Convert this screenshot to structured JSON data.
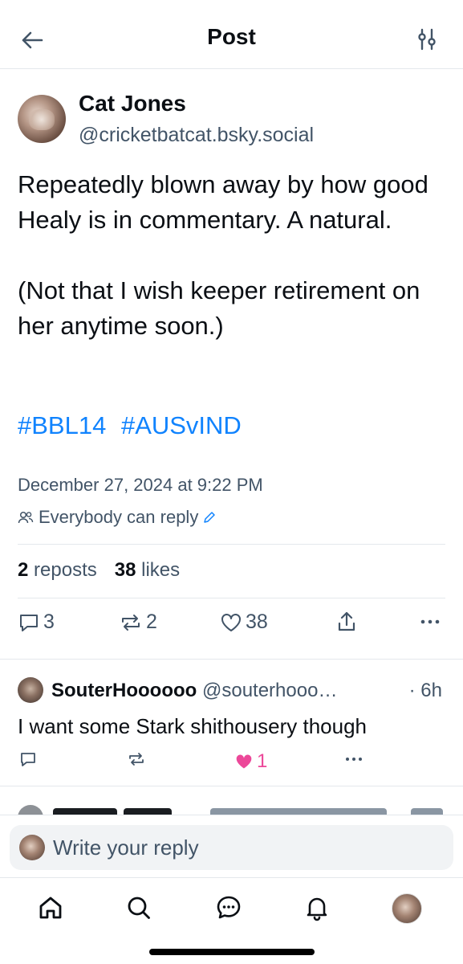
{
  "header": {
    "title": "Post"
  },
  "post": {
    "author_name": "Cat Jones",
    "author_handle": "@cricketbatcat.bsky.social",
    "text": "Repeatedly blown away by how good Healy is in commentary. A natural.\n\n(Not that I wish keeper retirement on her anytime soon.)",
    "hashtags": [
      "#BBL14",
      "#AUSvIND"
    ],
    "timestamp": "December 27, 2024 at 9:22 PM",
    "reply_setting": "Everybody can reply",
    "reposts_count": "2",
    "reposts_label": "reposts",
    "likes_count": "38",
    "likes_label": "likes",
    "actions": {
      "replies": "3",
      "reposts": "2",
      "likes": "38"
    }
  },
  "reply": {
    "name": "SouterHoooooo",
    "handle": "@souterhooo…",
    "time": "· 6h",
    "text": "I want some Stark shithousery though",
    "likes": "1",
    "accent_color": "#ec4899"
  },
  "composer": {
    "placeholder": "Write your reply"
  },
  "colors": {
    "accent": "#1083fe",
    "muted": "#425467",
    "text": "#0b0f14",
    "like": "#ec4899"
  },
  "icons": [
    "back-arrow-icon",
    "filter-icon",
    "people-icon",
    "edit-pencil-icon",
    "reply-icon",
    "repost-icon",
    "heart-icon",
    "share-icon",
    "more-icon",
    "home-icon",
    "search-icon",
    "chat-icon",
    "bell-icon"
  ]
}
